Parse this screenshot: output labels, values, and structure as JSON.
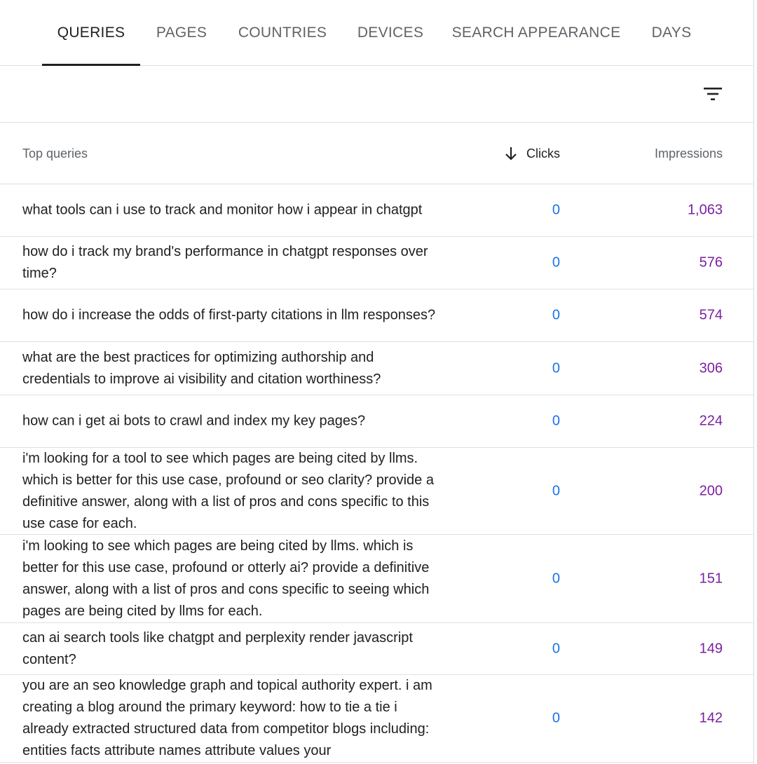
{
  "tabs": [
    {
      "label": "QUERIES"
    },
    {
      "label": "PAGES"
    },
    {
      "label": "COUNTRIES"
    },
    {
      "label": "DEVICES"
    },
    {
      "label": "SEARCH APPEARANCE"
    },
    {
      "label": "DAYS"
    }
  ],
  "active_tab": "QUERIES",
  "filter": {
    "icon": "filter-list-icon"
  },
  "table": {
    "headers": {
      "query": "Top queries",
      "clicks": "Clicks",
      "impressions": "Impressions"
    },
    "sort": {
      "column": "Clicks",
      "direction": "descending",
      "icon": "arrow-down-icon"
    },
    "rows": [
      {
        "query": "what tools can i use to track and monitor how i appear in chatgpt",
        "clicks": "0",
        "impressions": "1,063"
      },
      {
        "query": "how do i track my brand's performance in chatgpt responses over time?",
        "clicks": "0",
        "impressions": "576"
      },
      {
        "query": "how do i increase the odds of first-party citations in llm responses?",
        "clicks": "0",
        "impressions": "574"
      },
      {
        "query": "what are the best practices for optimizing authorship and credentials to improve ai visibility and citation worthiness?",
        "clicks": "0",
        "impressions": "306"
      },
      {
        "query": "how can i get ai bots to crawl and index my key pages?",
        "clicks": "0",
        "impressions": "224"
      },
      {
        "query": "i'm looking for a tool to see which pages are being cited by llms. which is better for this use case, profound or seo clarity? provide a definitive answer, along with a list of pros and cons specific to this use case for each.",
        "clicks": "0",
        "impressions": "200"
      },
      {
        "query": "i'm looking to see which pages are being cited by llms. which is better for this use case, profound or otterly ai? provide a definitive answer, along with a list of pros and cons specific to seeing which pages are being cited by llms for each.",
        "clicks": "0",
        "impressions": "151"
      },
      {
        "query": "can ai search tools like chatgpt and perplexity render javascript content?",
        "clicks": "0",
        "impressions": "149"
      },
      {
        "query": "you are an seo knowledge graph and topical authority expert. i am creating a blog around the primary keyword: how to tie a tie i already extracted structured data from competitor blogs including: entities facts attribute names attribute values your",
        "clicks": "0",
        "impressions": "142"
      }
    ]
  },
  "colors": {
    "clicks": "#1a73e8",
    "impressions": "#7b1fa2",
    "text": "#202124",
    "muted": "#5f6368",
    "divider": "#e0e0e0"
  }
}
